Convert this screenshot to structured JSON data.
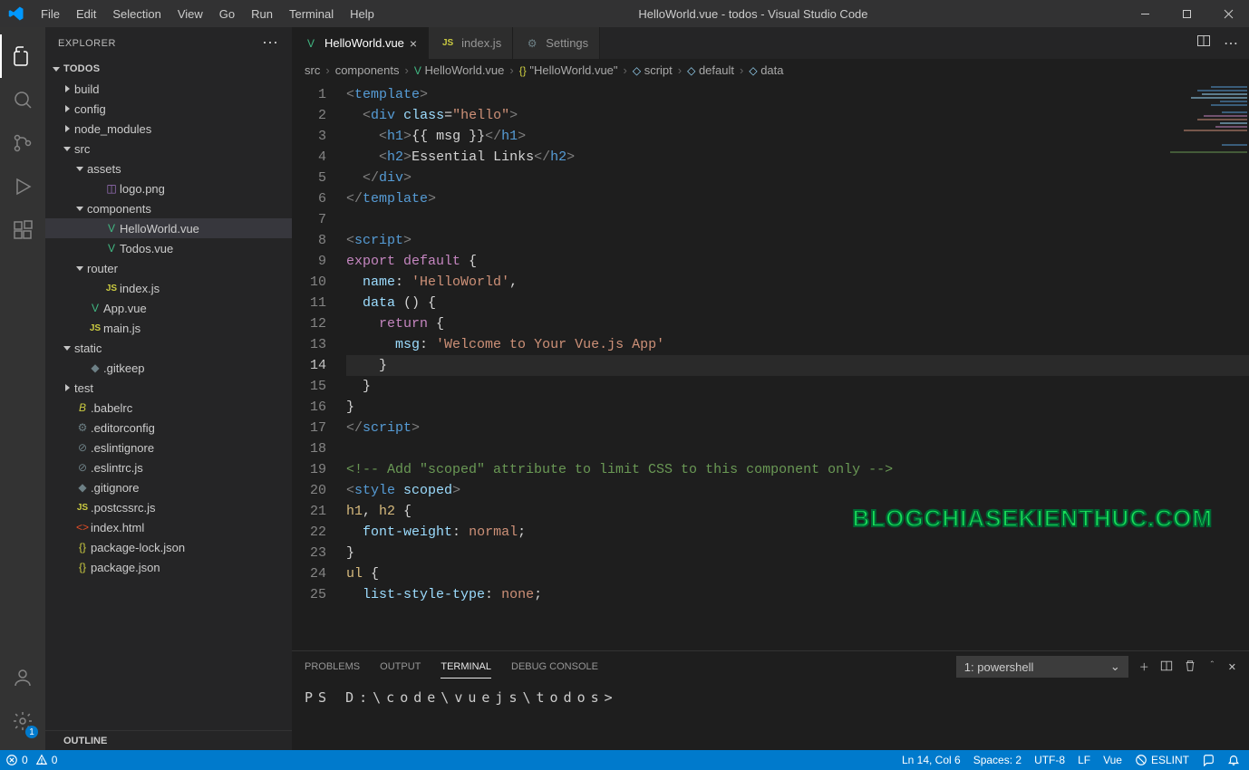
{
  "title": "HelloWorld.vue - todos - Visual Studio Code",
  "menu": [
    "File",
    "Edit",
    "Selection",
    "View",
    "Go",
    "Run",
    "Terminal",
    "Help"
  ],
  "sidebar": {
    "title": "EXPLORER",
    "root": "TODOS",
    "outline": "OUTLINE",
    "items": [
      {
        "pad": 16,
        "tw": "r",
        "icon": "",
        "cls": "",
        "label": "build"
      },
      {
        "pad": 16,
        "tw": "r",
        "icon": "",
        "cls": "",
        "label": "config"
      },
      {
        "pad": 16,
        "tw": "r",
        "icon": "",
        "cls": "",
        "label": "node_modules"
      },
      {
        "pad": 16,
        "tw": "d",
        "icon": "",
        "cls": "",
        "label": "src"
      },
      {
        "pad": 30,
        "tw": "d",
        "icon": "",
        "cls": "",
        "label": "assets"
      },
      {
        "pad": 48,
        "tw": "",
        "icon": "◫",
        "cls": "c-img",
        "label": "logo.png"
      },
      {
        "pad": 30,
        "tw": "d",
        "icon": "",
        "cls": "",
        "label": "components"
      },
      {
        "pad": 48,
        "tw": "",
        "icon": "V",
        "cls": "c-vue",
        "label": "HelloWorld.vue",
        "sel": true
      },
      {
        "pad": 48,
        "tw": "",
        "icon": "V",
        "cls": "c-vue",
        "label": "Todos.vue"
      },
      {
        "pad": 30,
        "tw": "d",
        "icon": "",
        "cls": "",
        "label": "router"
      },
      {
        "pad": 48,
        "tw": "",
        "icon": "JS",
        "cls": "c-js",
        "label": "index.js"
      },
      {
        "pad": 30,
        "tw": "",
        "icon": "V",
        "cls": "c-vue",
        "label": "App.vue"
      },
      {
        "pad": 30,
        "tw": "",
        "icon": "JS",
        "cls": "c-js",
        "label": "main.js"
      },
      {
        "pad": 16,
        "tw": "d",
        "icon": "",
        "cls": "",
        "label": "static"
      },
      {
        "pad": 30,
        "tw": "",
        "icon": "◆",
        "cls": "c-cfg",
        "label": ".gitkeep"
      },
      {
        "pad": 16,
        "tw": "r",
        "icon": "",
        "cls": "",
        "label": "test"
      },
      {
        "pad": 16,
        "tw": "",
        "icon": "B",
        "cls": "c-babel",
        "label": ".babelrc"
      },
      {
        "pad": 16,
        "tw": "",
        "icon": "⚙",
        "cls": "c-cfg",
        "label": ".editorconfig"
      },
      {
        "pad": 16,
        "tw": "",
        "icon": "⊘",
        "cls": "c-cfg",
        "label": ".eslintignore"
      },
      {
        "pad": 16,
        "tw": "",
        "icon": "⊘",
        "cls": "c-cfg",
        "label": ".eslintrc.js"
      },
      {
        "pad": 16,
        "tw": "",
        "icon": "◆",
        "cls": "c-cfg",
        "label": ".gitignore"
      },
      {
        "pad": 16,
        "tw": "",
        "icon": "JS",
        "cls": "c-js",
        "label": ".postcssrc.js"
      },
      {
        "pad": 16,
        "tw": "",
        "icon": "<>",
        "cls": "c-html",
        "label": "index.html"
      },
      {
        "pad": 16,
        "tw": "",
        "icon": "{}",
        "cls": "c-json",
        "label": "package-lock.json"
      },
      {
        "pad": 16,
        "tw": "",
        "icon": "{}",
        "cls": "c-json",
        "label": "package.json"
      }
    ]
  },
  "tabs": [
    {
      "icon": "V",
      "cls": "c-vue",
      "label": "HelloWorld.vue",
      "active": true,
      "close": true
    },
    {
      "icon": "JS",
      "cls": "c-js",
      "label": "index.js",
      "active": false,
      "close": false
    },
    {
      "icon": "⚙",
      "cls": "c-cfg",
      "label": "Settings",
      "active": false,
      "close": false
    }
  ],
  "breadcrumbs": [
    {
      "icon": "",
      "cls": "",
      "label": "src"
    },
    {
      "icon": "",
      "cls": "",
      "label": "components"
    },
    {
      "icon": "V",
      "cls": "c-vue",
      "label": "HelloWorld.vue"
    },
    {
      "icon": "{}",
      "cls": "c-json",
      "label": "\"HelloWorld.vue\""
    },
    {
      "icon": "◇",
      "cls": "t-prop",
      "label": "script"
    },
    {
      "icon": "◇",
      "cls": "t-prop",
      "label": "default"
    },
    {
      "icon": "◇",
      "cls": "t-name",
      "label": "data"
    }
  ],
  "code": {
    "lines": [
      [
        {
          "c": "t-angle",
          "t": "<"
        },
        {
          "c": "t-tag",
          "t": "template"
        },
        {
          "c": "t-angle",
          "t": ">"
        }
      ],
      [
        {
          "c": "t-text",
          "t": "  "
        },
        {
          "c": "t-angle",
          "t": "<"
        },
        {
          "c": "t-tag",
          "t": "div"
        },
        {
          "c": "t-text",
          "t": " "
        },
        {
          "c": "t-attr",
          "t": "class"
        },
        {
          "c": "t-text",
          "t": "="
        },
        {
          "c": "t-str",
          "t": "\"hello\""
        },
        {
          "c": "t-angle",
          "t": ">"
        }
      ],
      [
        {
          "c": "t-text",
          "t": "    "
        },
        {
          "c": "t-angle",
          "t": "<"
        },
        {
          "c": "t-tag",
          "t": "h1"
        },
        {
          "c": "t-angle",
          "t": ">"
        },
        {
          "c": "t-text",
          "t": "{{ msg }}"
        },
        {
          "c": "t-angle",
          "t": "</"
        },
        {
          "c": "t-tag",
          "t": "h1"
        },
        {
          "c": "t-angle",
          "t": ">"
        }
      ],
      [
        {
          "c": "t-text",
          "t": "    "
        },
        {
          "c": "t-angle",
          "t": "<"
        },
        {
          "c": "t-tag",
          "t": "h2"
        },
        {
          "c": "t-angle",
          "t": ">"
        },
        {
          "c": "t-text",
          "t": "Essential Links"
        },
        {
          "c": "t-angle",
          "t": "</"
        },
        {
          "c": "t-tag",
          "t": "h2"
        },
        {
          "c": "t-angle",
          "t": ">"
        }
      ],
      [
        {
          "c": "t-text",
          "t": "  "
        },
        {
          "c": "t-angle",
          "t": "</"
        },
        {
          "c": "t-tag",
          "t": "div"
        },
        {
          "c": "t-angle",
          "t": ">"
        }
      ],
      [
        {
          "c": "t-angle",
          "t": "</"
        },
        {
          "c": "t-tag",
          "t": "template"
        },
        {
          "c": "t-angle",
          "t": ">"
        }
      ],
      [],
      [
        {
          "c": "t-angle",
          "t": "<"
        },
        {
          "c": "t-tag",
          "t": "script"
        },
        {
          "c": "t-angle",
          "t": ">"
        }
      ],
      [
        {
          "c": "t-kw",
          "t": "export"
        },
        {
          "c": "t-text",
          "t": " "
        },
        {
          "c": "t-kw",
          "t": "default"
        },
        {
          "c": "t-text",
          "t": " {"
        }
      ],
      [
        {
          "c": "t-text",
          "t": "  "
        },
        {
          "c": "t-name",
          "t": "name"
        },
        {
          "c": "t-text",
          "t": ": "
        },
        {
          "c": "t-str",
          "t": "'HelloWorld'"
        },
        {
          "c": "t-text",
          "t": ","
        }
      ],
      [
        {
          "c": "t-text",
          "t": "  "
        },
        {
          "c": "t-name",
          "t": "data"
        },
        {
          "c": "t-text",
          "t": " () {"
        }
      ],
      [
        {
          "c": "t-text",
          "t": "    "
        },
        {
          "c": "t-kw",
          "t": "return"
        },
        {
          "c": "t-text",
          "t": " {"
        }
      ],
      [
        {
          "c": "t-text",
          "t": "      "
        },
        {
          "c": "t-name",
          "t": "msg"
        },
        {
          "c": "t-text",
          "t": ": "
        },
        {
          "c": "t-str",
          "t": "'Welcome to Your Vue.js App'"
        }
      ],
      [
        {
          "c": "t-text",
          "t": "    }"
        }
      ],
      [
        {
          "c": "t-text",
          "t": "  }"
        }
      ],
      [
        {
          "c": "t-text",
          "t": "}"
        }
      ],
      [
        {
          "c": "t-angle",
          "t": "</"
        },
        {
          "c": "t-tag",
          "t": "script"
        },
        {
          "c": "t-angle",
          "t": ">"
        }
      ],
      [],
      [
        {
          "c": "t-cmt",
          "t": "<!-- Add \"scoped\" attribute to limit CSS to this component only -->"
        }
      ],
      [
        {
          "c": "t-angle",
          "t": "<"
        },
        {
          "c": "t-tag",
          "t": "style"
        },
        {
          "c": "t-text",
          "t": " "
        },
        {
          "c": "t-attr",
          "t": "scoped"
        },
        {
          "c": "t-angle",
          "t": ">"
        }
      ],
      [
        {
          "c": "t-sel",
          "t": "h1"
        },
        {
          "c": "t-text",
          "t": ", "
        },
        {
          "c": "t-sel",
          "t": "h2"
        },
        {
          "c": "t-text",
          "t": " {"
        }
      ],
      [
        {
          "c": "t-text",
          "t": "  "
        },
        {
          "c": "t-prop",
          "t": "font-weight"
        },
        {
          "c": "t-text",
          "t": ": "
        },
        {
          "c": "t-val",
          "t": "normal"
        },
        {
          "c": "t-text",
          "t": ";"
        }
      ],
      [
        {
          "c": "t-text",
          "t": "}"
        }
      ],
      [
        {
          "c": "t-sel",
          "t": "ul"
        },
        {
          "c": "t-text",
          "t": " {"
        }
      ],
      [
        {
          "c": "t-text",
          "t": "  "
        },
        {
          "c": "t-prop",
          "t": "list-style-type"
        },
        {
          "c": "t-text",
          "t": ": "
        },
        {
          "c": "t-val",
          "t": "none"
        },
        {
          "c": "t-text",
          "t": ";"
        }
      ]
    ],
    "current_line": 14
  },
  "panel": {
    "tabs": [
      "PROBLEMS",
      "OUTPUT",
      "TERMINAL",
      "DEBUG CONSOLE"
    ],
    "active": 2,
    "terminal_selector": "1: powershell",
    "prompt": "PS D:\\code\\vuejs\\todos>"
  },
  "status": {
    "errors": "0",
    "warnings": "0",
    "line_col": "Ln 14, Col 6",
    "spaces": "Spaces: 2",
    "encoding": "UTF-8",
    "eol": "LF",
    "lang": "Vue",
    "eslint": "ESLINT"
  },
  "watermark": "BLOGCHIASEKIENTHUC.COM",
  "settings_badge": "1"
}
